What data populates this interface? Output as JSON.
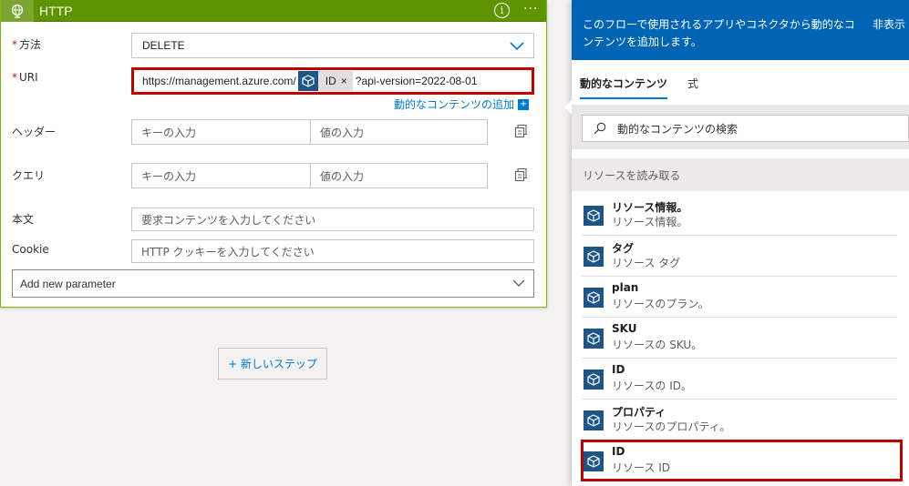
{
  "card": {
    "title": "HTTP",
    "info_glyph": "i",
    "more_glyph": "···",
    "method": {
      "label": "方法",
      "required_mark": "*",
      "value": "DELETE"
    },
    "uri": {
      "label": "URI",
      "required_mark": "*",
      "prefix": "https://management.azure.com/",
      "token_label": "ID",
      "token_remove": "×",
      "suffix": "?api-version=2022-08-01"
    },
    "add_dynamic_link": "動的なコンテンツの追加",
    "add_dynamic_plus": "+",
    "headers": {
      "label": "ヘッダー",
      "key_placeholder": "キーの入力",
      "value_placeholder": "値の入力"
    },
    "query": {
      "label": "クエリ",
      "key_placeholder": "キーの入力",
      "value_placeholder": "値の入力"
    },
    "body": {
      "label": "本文",
      "placeholder": "要求コンテンツを入力してください"
    },
    "cookie": {
      "label": "Cookie",
      "placeholder": "HTTP クッキーを入力してください"
    },
    "add_param": "Add new parameter"
  },
  "new_step": "+ 新しいステップ",
  "panel": {
    "header_text": "このフローで使用されるアプリやコネクタから動的なコンテンツを追加します。",
    "hide_text": "非表示",
    "tabs": [
      {
        "label": "動的なコンテンツ",
        "active": true
      },
      {
        "label": "式",
        "active": false
      }
    ],
    "search_placeholder": "動的なコンテンツの検索",
    "section_title": "リソースを読み取る",
    "items": [
      {
        "title": "リソース情報。",
        "desc": "リソース情報。"
      },
      {
        "title": "タグ",
        "desc": "リソース タグ"
      },
      {
        "title": "plan",
        "desc": "リソースのプラン。"
      },
      {
        "title": "SKU",
        "desc": "リソースの SKU。"
      },
      {
        "title": "ID",
        "desc": "リソースの ID。"
      },
      {
        "title": "プロパティ",
        "desc": "リソースのプロパティ。"
      },
      {
        "title": "ID",
        "desc": "リソース ID"
      }
    ]
  },
  "colors": {
    "card_header": "#5e9400",
    "accent_blue": "#0078d4",
    "panel_header": "#0064b4",
    "highlight_red": "#c00000",
    "token_icon": "#1f5486"
  }
}
